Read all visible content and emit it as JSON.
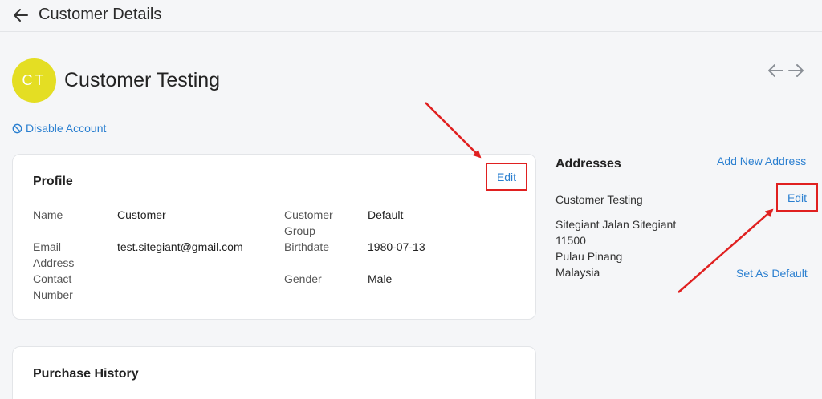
{
  "header": {
    "title": "Customer Details"
  },
  "customer": {
    "initials": "CT",
    "name": "Customer Testing",
    "avatar_color": "#e4de23"
  },
  "actions": {
    "disable_account": "Disable Account"
  },
  "profile": {
    "title": "Profile",
    "edit_label": "Edit",
    "fields": {
      "name_label": "Name",
      "name_value": "Customer",
      "email_label": "Email Address",
      "email_value": "test.sitegiant@gmail.com",
      "contact_label": "Contact Number",
      "contact_value": "",
      "group_label": "Customer Group",
      "group_value": "Default",
      "birthdate_label": "Birthdate",
      "birthdate_value": "1980-07-13",
      "gender_label": "Gender",
      "gender_value": "Male"
    }
  },
  "addresses": {
    "title": "Addresses",
    "add_label": "Add New Address",
    "edit_label": "Edit",
    "set_default_label": "Set As Default",
    "items": [
      {
        "name": "Customer Testing",
        "line1": "Sitegiant Jalan Sitegiant",
        "postcode": "11500",
        "state": "Pulau Pinang",
        "country": "Malaysia"
      }
    ]
  },
  "purchase_history": {
    "title": "Purchase History"
  },
  "colors": {
    "link": "#2a7fd0",
    "annotation": "#e02020",
    "background": "#f5f6f8"
  }
}
